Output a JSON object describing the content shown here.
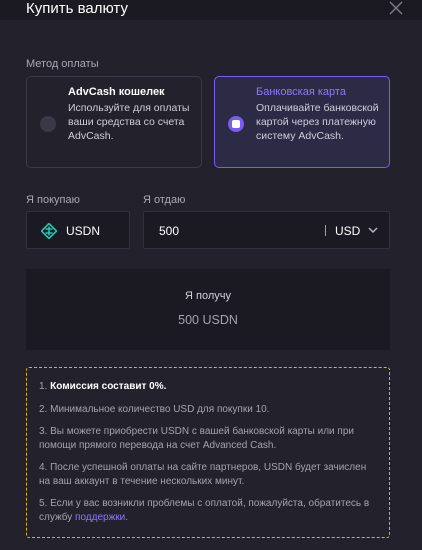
{
  "header": {
    "title": "Купить валюту"
  },
  "payment_method": {
    "label": "Метод оплаты",
    "options": [
      {
        "title": "AdvCash кошелек",
        "description": "Используйте для оплаты ваши средства со счета AdvCash.",
        "selected": false
      },
      {
        "title": "Банковская карта",
        "description": "Оплачивайте банковской картой через платежную систему AdvCash.",
        "selected": true
      }
    ]
  },
  "buy": {
    "label": "Я покупаю",
    "currency": "USDN",
    "icon": "usdn-coin-icon"
  },
  "give": {
    "label": "Я отдаю",
    "amount": "500",
    "currency": "USD"
  },
  "receive": {
    "label": "Я получу",
    "value": "500 USDN"
  },
  "notice": {
    "item1_prefix": "1. ",
    "item1_bold": "Комиссия составит 0%.",
    "item2": "2. Минимальное количество USD для покупки 10.",
    "item3": "3. Вы можете приобрести USDN с вашей банковской карты или при помощи прямого перевода на счет Advanced Cash.",
    "item4": "4. После успешной оплаты на сайте партнеров, USDN будет зачислен на ваш аккаунт в течение нескольких минут.",
    "item5_text": "5. Если у вас возникли проблемы с оплатой, пожалуйста, обратитесь в службу ",
    "item5_link": "поддержки",
    "item5_suffix": "."
  },
  "colors": {
    "accent": "#7a5cf2",
    "notice_border": "#d9b320",
    "coin": "#1ec7b0"
  }
}
